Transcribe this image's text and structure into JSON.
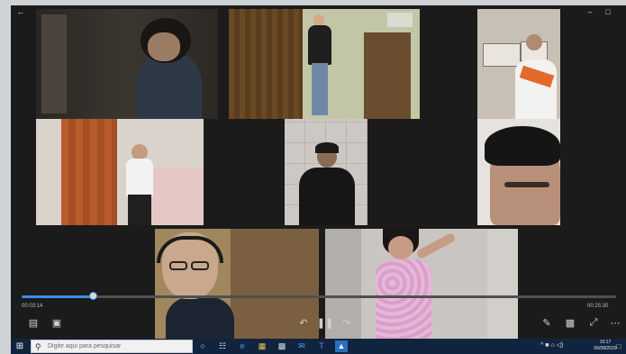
{
  "window": {
    "back_icon": "back-arrow-icon",
    "controls": [
      "minimize-icon",
      "restore-icon"
    ]
  },
  "tiles": [
    {
      "name": "video-tile-child-curly-hair",
      "description": "child with dark curly hair in dark room"
    },
    {
      "name": "video-tile-man-standing",
      "description": "man standing by wooden wardrobe"
    },
    {
      "name": "video-tile-boy-holding-paper",
      "description": "boy holding papers near wall drawings"
    },
    {
      "name": "video-tile-girl-bedroom",
      "description": "girl standing in bedroom by door"
    },
    {
      "name": "video-tile-boy-tiled-wall",
      "description": "boy against tiled wall"
    },
    {
      "name": "video-tile-girl-closeup",
      "description": "close-up face with dark hair"
    },
    {
      "name": "video-tile-boy-headphones",
      "description": "boy with glasses and headphones"
    },
    {
      "name": "video-tile-girl-pink-dress",
      "description": "girl in pink patterned dress"
    }
  ],
  "player": {
    "progress": 0.12,
    "time_elapsed": "00:03:14",
    "time_remaining": "00:25:30",
    "left_controls": [
      "captions-icon",
      "aspect-icon"
    ],
    "center_controls": [
      "rewind-icon",
      "play-pause-icon",
      "forward-icon"
    ],
    "right_controls": [
      "edit-icon",
      "mini-view-icon",
      "fullscreen-icon",
      "more-icon"
    ]
  },
  "taskbar": {
    "search_placeholder": "Digite aqui para pesquisar",
    "pinned": [
      "cortana-icon",
      "task-view-icon",
      "edge-icon",
      "file-explorer-icon",
      "store-icon",
      "mail-icon",
      "teams-icon",
      "photos-icon"
    ],
    "tray": "^ ■ ⌂ ◁)",
    "time": "10:17",
    "date": "06/08/2020",
    "colors": {
      "taskbar": "#10243f",
      "accent": "#3c8de8"
    }
  }
}
